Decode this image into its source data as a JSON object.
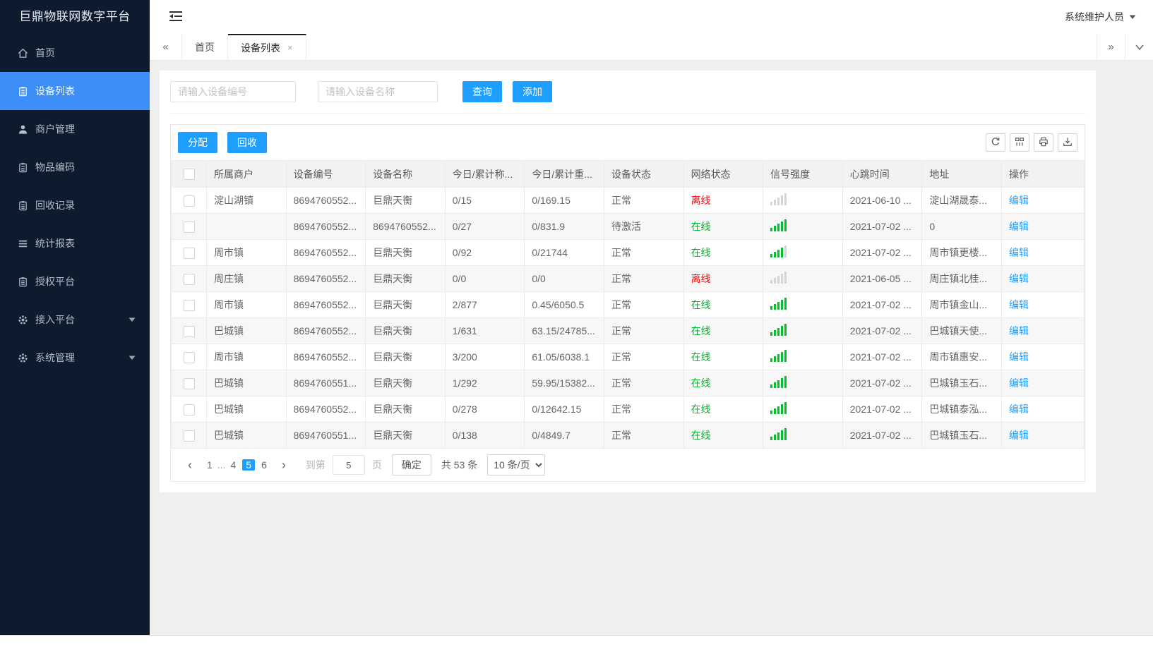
{
  "app": {
    "title": "巨鼎物联网数字平台",
    "user": "系统维护人员"
  },
  "colors": {
    "accent": "#1E9FFF",
    "sidebar_active": "#3E8EF7",
    "online_green": "#00b42a",
    "offline_red": "#ff0000",
    "signal_green": "#00c12b"
  },
  "sidebar": {
    "items": [
      {
        "name": "home",
        "label": "首页",
        "icon": "home",
        "active": false,
        "caret": false
      },
      {
        "name": "device-list",
        "label": "设备列表",
        "icon": "doc",
        "active": true,
        "caret": false
      },
      {
        "name": "merchant-mgmt",
        "label": "商户管理",
        "icon": "user",
        "active": false,
        "caret": false
      },
      {
        "name": "item-code",
        "label": "物品编码",
        "icon": "doc",
        "active": false,
        "caret": false
      },
      {
        "name": "recycle-record",
        "label": "回收记录",
        "icon": "doc",
        "active": false,
        "caret": false
      },
      {
        "name": "stats-report",
        "label": "统计报表",
        "icon": "lines",
        "active": false,
        "caret": false
      },
      {
        "name": "auth-platform",
        "label": "授权平台",
        "icon": "doc",
        "active": false,
        "caret": false
      },
      {
        "name": "access-platform",
        "label": "接入平台",
        "icon": "gear",
        "active": false,
        "caret": true
      },
      {
        "name": "system-mgmt",
        "label": "系统管理",
        "icon": "gear",
        "active": false,
        "caret": true
      }
    ]
  },
  "tabs": {
    "items": [
      {
        "name": "home",
        "label": "首页",
        "active": false,
        "closable": false
      },
      {
        "name": "device-list",
        "label": "设备列表",
        "active": true,
        "closable": true
      }
    ]
  },
  "search": {
    "device_no_placeholder": "请输入设备编号",
    "device_name_placeholder": "请输入设备名称",
    "query_label": "查询",
    "add_label": "添加"
  },
  "toolbar": {
    "assign_label": "分配",
    "recycle_label": "回收",
    "icon_buttons": [
      "refresh",
      "columns",
      "print",
      "export"
    ]
  },
  "table": {
    "columns": [
      "所属商户",
      "设备编号",
      "设备名称",
      "今日/累计称...",
      "今日/累计重...",
      "设备状态",
      "网络状态",
      "信号强度",
      "心跳时间",
      "地址",
      "操作"
    ],
    "edit_label": "编辑",
    "online_label": "在线",
    "rows": [
      {
        "merchant": "淀山湖镇",
        "device_no": "8694760552...",
        "device_name": "巨鼎天衡",
        "today_total_count": "0/15",
        "today_total_weight": "0/169.15",
        "device_status": "正常",
        "network_status": "离线",
        "signal_level": 0,
        "heartbeat": "2021-06-10 ...",
        "address": "淀山湖晟泰..."
      },
      {
        "merchant": "",
        "device_no": "8694760552...",
        "device_name": "8694760552...",
        "today_total_count": "0/27",
        "today_total_weight": "0/831.9",
        "device_status": "待激活",
        "network_status": "在线",
        "signal_level": 5,
        "heartbeat": "2021-07-02 ...",
        "address": "0"
      },
      {
        "merchant": "周市镇",
        "device_no": "8694760552...",
        "device_name": "巨鼎天衡",
        "today_total_count": "0/92",
        "today_total_weight": "0/21744",
        "device_status": "正常",
        "network_status": "在线",
        "signal_level": 4,
        "heartbeat": "2021-07-02 ...",
        "address": "周市镇更楼..."
      },
      {
        "merchant": "周庄镇",
        "device_no": "8694760552...",
        "device_name": "巨鼎天衡",
        "today_total_count": "0/0",
        "today_total_weight": "0/0",
        "device_status": "正常",
        "network_status": "离线",
        "signal_level": 0,
        "heartbeat": "2021-06-05 ...",
        "address": "周庄镇北桂..."
      },
      {
        "merchant": "周市镇",
        "device_no": "8694760552...",
        "device_name": "巨鼎天衡",
        "today_total_count": "2/877",
        "today_total_weight": "0.45/6050.5",
        "device_status": "正常",
        "network_status": "在线",
        "signal_level": 5,
        "heartbeat": "2021-07-02 ...",
        "address": "周市镇金山..."
      },
      {
        "merchant": "巴城镇",
        "device_no": "8694760552...",
        "device_name": "巨鼎天衡",
        "today_total_count": "1/631",
        "today_total_weight": "63.15/24785...",
        "device_status": "正常",
        "network_status": "在线",
        "signal_level": 5,
        "heartbeat": "2021-07-02 ...",
        "address": "巴城镇天使..."
      },
      {
        "merchant": "周市镇",
        "device_no": "8694760552...",
        "device_name": "巨鼎天衡",
        "today_total_count": "3/200",
        "today_total_weight": "61.05/6038.1",
        "device_status": "正常",
        "network_status": "在线",
        "signal_level": 5,
        "heartbeat": "2021-07-02 ...",
        "address": "周市镇惠安..."
      },
      {
        "merchant": "巴城镇",
        "device_no": "8694760551...",
        "device_name": "巨鼎天衡",
        "today_total_count": "1/292",
        "today_total_weight": "59.95/15382...",
        "device_status": "正常",
        "network_status": "在线",
        "signal_level": 5,
        "heartbeat": "2021-07-02 ...",
        "address": "巴城镇玉石..."
      },
      {
        "merchant": "巴城镇",
        "device_no": "8694760552...",
        "device_name": "巨鼎天衡",
        "today_total_count": "0/278",
        "today_total_weight": "0/12642.15",
        "device_status": "正常",
        "network_status": "在线",
        "signal_level": 5,
        "heartbeat": "2021-07-02 ...",
        "address": "巴城镇泰泓..."
      },
      {
        "merchant": "巴城镇",
        "device_no": "8694760551...",
        "device_name": "巨鼎天衡",
        "today_total_count": "0/138",
        "today_total_weight": "0/4849.7",
        "device_status": "正常",
        "network_status": "在线",
        "signal_level": 5,
        "heartbeat": "2021-07-02 ...",
        "address": "巴城镇玉石..."
      }
    ]
  },
  "pagination": {
    "pages": [
      "1",
      "...",
      "4",
      "5",
      "6"
    ],
    "active_page": "5",
    "goto_prefix": "到第",
    "goto_value": "5",
    "goto_suffix": "页",
    "confirm_label": "确定",
    "total_text": "共 53 条",
    "page_size_text": "10 条/页"
  }
}
